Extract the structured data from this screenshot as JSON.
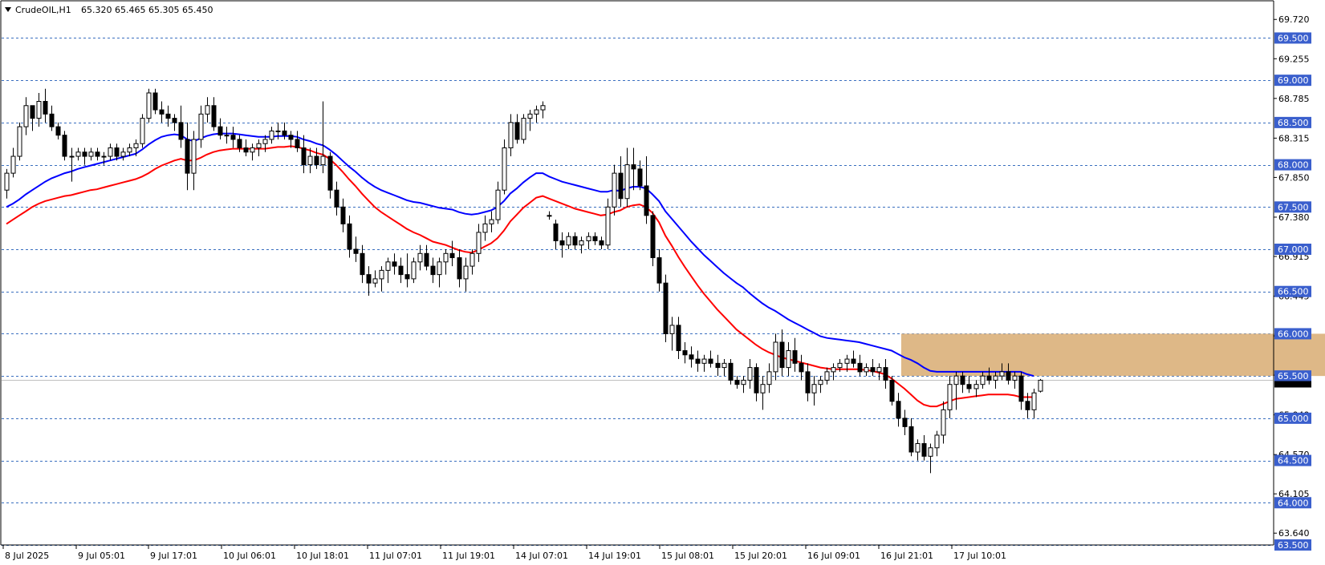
{
  "window": {
    "symbol": "CrudeOIL,H1",
    "ohlc": "65.320 65.465 65.305 65.450"
  },
  "colors": {
    "background": "#ffffff",
    "grid_dash": "#3a6fbf",
    "level_label_bg": "#3a5fcd",
    "ema_fast": "#0000ff",
    "ema_slow": "#ff0000",
    "zone_fill": "#deb887",
    "bull_body": "#ffffff",
    "bear_body": "#000000",
    "current_price_line": "#c0c0c0"
  },
  "chart_data": {
    "type": "candlestick",
    "title": "CrudeOIL,H1",
    "ylim": [
      63.5,
      69.95
    ],
    "y_ticks": [
      "69.720",
      "69.255",
      "68.785",
      "68.315",
      "67.850",
      "67.380",
      "66.915",
      "66.445",
      "65.975",
      "65.510",
      "65.040",
      "64.570",
      "64.105",
      "63.640"
    ],
    "x_tick_labels": [
      "8 Jul 2025",
      "9 Jul 05:01",
      "9 Jul 17:01",
      "10 Jul 06:01",
      "10 Jul 18:01",
      "11 Jul 07:01",
      "11 Jul 19:01",
      "14 Jul 07:01",
      "14 Jul 19:01",
      "15 Jul 08:01",
      "15 Jul 20:01",
      "16 Jul 09:01",
      "16 Jul 21:01",
      "17 Jul 10:01"
    ],
    "levels": [
      "69.500",
      "69.000",
      "68.500",
      "68.000",
      "67.500",
      "67.000",
      "66.500",
      "66.000",
      "65.500",
      "65.000",
      "64.500",
      "64.000",
      "63.500"
    ],
    "current_price": "65.450",
    "zone": {
      "x_start": 139,
      "x_end": 208,
      "y_low": 65.5,
      "y_high": 66.0
    },
    "candles": [
      [
        67.7,
        67.95,
        67.6,
        67.9
      ],
      [
        67.9,
        68.2,
        67.85,
        68.1
      ],
      [
        68.1,
        68.5,
        68.05,
        68.45
      ],
      [
        68.45,
        68.8,
        68.35,
        68.7
      ],
      [
        68.7,
        68.55,
        68.4,
        68.55
      ],
      [
        68.55,
        68.85,
        68.45,
        68.75
      ],
      [
        68.75,
        68.9,
        68.5,
        68.6
      ],
      [
        68.6,
        68.7,
        68.4,
        68.45
      ],
      [
        68.45,
        68.5,
        68.3,
        68.35
      ],
      [
        68.35,
        68.4,
        68.05,
        68.1
      ],
      [
        68.1,
        68.2,
        67.8,
        68.1
      ],
      [
        68.1,
        68.2,
        68.05,
        68.15
      ],
      [
        68.15,
        68.2,
        68.0,
        68.1
      ],
      [
        68.1,
        68.2,
        68.05,
        68.15
      ],
      [
        68.15,
        68.2,
        68.05,
        68.1
      ],
      [
        68.1,
        68.15,
        68.0,
        68.1
      ],
      [
        68.1,
        68.25,
        68.05,
        68.2
      ],
      [
        68.2,
        68.25,
        68.05,
        68.1
      ],
      [
        68.1,
        68.2,
        68.05,
        68.15
      ],
      [
        68.15,
        68.25,
        68.1,
        68.2
      ],
      [
        68.2,
        68.3,
        68.1,
        68.25
      ],
      [
        68.25,
        68.6,
        68.2,
        68.55
      ],
      [
        68.55,
        68.9,
        68.5,
        68.85
      ],
      [
        68.85,
        68.9,
        68.6,
        68.65
      ],
      [
        68.65,
        68.75,
        68.5,
        68.6
      ],
      [
        68.6,
        68.7,
        68.45,
        68.55
      ],
      [
        68.55,
        68.6,
        68.4,
        68.5
      ],
      [
        68.5,
        68.7,
        68.2,
        68.3
      ],
      [
        68.3,
        68.5,
        67.7,
        67.9
      ],
      [
        67.9,
        68.4,
        67.7,
        68.3
      ],
      [
        68.3,
        68.7,
        68.2,
        68.6
      ],
      [
        68.6,
        68.8,
        68.5,
        68.7
      ],
      [
        68.7,
        68.8,
        68.4,
        68.45
      ],
      [
        68.45,
        68.55,
        68.3,
        68.35
      ],
      [
        68.35,
        68.45,
        68.25,
        68.35
      ],
      [
        68.35,
        68.45,
        68.2,
        68.3
      ],
      [
        68.3,
        68.35,
        68.15,
        68.2
      ],
      [
        68.2,
        68.3,
        68.1,
        68.15
      ],
      [
        68.15,
        68.25,
        68.05,
        68.2
      ],
      [
        68.2,
        68.3,
        68.1,
        68.25
      ],
      [
        68.25,
        68.35,
        68.15,
        68.3
      ],
      [
        68.3,
        68.45,
        68.25,
        68.4
      ],
      [
        68.4,
        68.5,
        68.3,
        68.4
      ],
      [
        68.4,
        68.5,
        68.3,
        68.35
      ],
      [
        68.35,
        68.4,
        68.2,
        68.3
      ],
      [
        68.3,
        68.4,
        68.15,
        68.2
      ],
      [
        68.2,
        68.35,
        67.9,
        68.0
      ],
      [
        68.0,
        68.2,
        67.9,
        68.1
      ],
      [
        68.1,
        68.2,
        67.95,
        68.0
      ],
      [
        68.0,
        68.75,
        67.9,
        68.1
      ],
      [
        68.1,
        68.15,
        67.6,
        67.7
      ],
      [
        67.7,
        67.8,
        67.4,
        67.5
      ],
      [
        67.5,
        67.6,
        67.2,
        67.3
      ],
      [
        67.3,
        67.4,
        66.9,
        67.0
      ],
      [
        67.0,
        67.15,
        66.85,
        66.95
      ],
      [
        66.95,
        67.05,
        66.6,
        66.7
      ],
      [
        66.7,
        66.8,
        66.45,
        66.6
      ],
      [
        66.6,
        66.75,
        66.55,
        66.65
      ],
      [
        66.65,
        66.8,
        66.5,
        66.75
      ],
      [
        66.75,
        66.9,
        66.6,
        66.85
      ],
      [
        66.85,
        66.95,
        66.7,
        66.8
      ],
      [
        66.8,
        66.9,
        66.6,
        66.7
      ],
      [
        66.7,
        66.95,
        66.55,
        66.65
      ],
      [
        66.65,
        66.9,
        66.6,
        66.85
      ],
      [
        66.85,
        67.05,
        66.75,
        66.95
      ],
      [
        66.95,
        67.05,
        66.75,
        66.8
      ],
      [
        66.8,
        66.9,
        66.6,
        66.7
      ],
      [
        66.7,
        66.9,
        66.55,
        66.85
      ],
      [
        66.85,
        67.0,
        66.7,
        66.95
      ],
      [
        66.95,
        67.1,
        66.8,
        66.9
      ],
      [
        66.9,
        67.0,
        66.55,
        66.65
      ],
      [
        66.65,
        66.9,
        66.5,
        66.8
      ],
      [
        66.8,
        67.0,
        66.7,
        66.95
      ],
      [
        66.95,
        67.3,
        66.85,
        67.2
      ],
      [
        67.2,
        67.4,
        67.1,
        67.3
      ],
      [
        67.3,
        67.45,
        67.2,
        67.35
      ],
      [
        67.35,
        67.8,
        67.3,
        67.7
      ],
      [
        67.7,
        68.3,
        67.65,
        68.2
      ],
      [
        68.2,
        68.6,
        68.1,
        68.5
      ],
      [
        68.5,
        68.6,
        68.25,
        68.3
      ],
      [
        68.3,
        68.6,
        68.25,
        68.55
      ],
      [
        68.55,
        68.65,
        68.4,
        68.6
      ],
      [
        68.6,
        68.7,
        68.5,
        68.65
      ],
      [
        68.65,
        68.75,
        68.55,
        68.7
      ],
      [
        67.4,
        67.45,
        67.35,
        67.4
      ],
      [
        67.3,
        67.35,
        67.0,
        67.1
      ],
      [
        67.1,
        67.2,
        66.9,
        67.05
      ],
      [
        67.05,
        67.2,
        67.0,
        67.15
      ],
      [
        67.15,
        67.2,
        67.0,
        67.05
      ],
      [
        67.05,
        67.15,
        66.95,
        67.1
      ],
      [
        67.1,
        67.2,
        67.0,
        67.15
      ],
      [
        67.15,
        67.2,
        67.05,
        67.1
      ],
      [
        67.1,
        67.15,
        67.0,
        67.05
      ],
      [
        67.05,
        67.6,
        67.0,
        67.5
      ],
      [
        67.5,
        68.0,
        67.4,
        67.9
      ],
      [
        67.9,
        68.1,
        67.5,
        67.6
      ],
      [
        67.6,
        68.2,
        67.5,
        68.0
      ],
      [
        68.0,
        68.2,
        67.7,
        67.95
      ],
      [
        67.95,
        68.05,
        67.7,
        67.75
      ],
      [
        67.75,
        68.1,
        67.3,
        67.4
      ],
      [
        67.4,
        67.45,
        66.8,
        66.9
      ],
      [
        66.9,
        67.0,
        66.5,
        66.6
      ],
      [
        66.6,
        66.7,
        65.9,
        66.0
      ],
      [
        66.0,
        66.2,
        65.8,
        66.1
      ],
      [
        66.1,
        66.2,
        65.7,
        65.8
      ],
      [
        65.8,
        65.9,
        65.65,
        65.75
      ],
      [
        65.75,
        65.85,
        65.6,
        65.7
      ],
      [
        65.7,
        65.8,
        65.55,
        65.65
      ],
      [
        65.65,
        65.75,
        65.55,
        65.7
      ],
      [
        65.7,
        65.8,
        65.6,
        65.65
      ],
      [
        65.65,
        65.75,
        65.5,
        65.6
      ],
      [
        65.6,
        65.7,
        65.5,
        65.65
      ],
      [
        65.65,
        65.7,
        65.4,
        65.45
      ],
      [
        65.45,
        65.5,
        65.35,
        65.4
      ],
      [
        65.4,
        65.5,
        65.3,
        65.45
      ],
      [
        65.45,
        65.7,
        65.35,
        65.6
      ],
      [
        65.6,
        65.65,
        65.2,
        65.3
      ],
      [
        65.3,
        65.5,
        65.1,
        65.4
      ],
      [
        65.4,
        65.65,
        65.3,
        65.55
      ],
      [
        65.55,
        66.0,
        65.45,
        65.9
      ],
      [
        65.9,
        66.05,
        65.5,
        65.6
      ],
      [
        65.6,
        65.9,
        65.5,
        65.8
      ],
      [
        65.8,
        65.95,
        65.55,
        65.65
      ],
      [
        65.65,
        65.75,
        65.45,
        65.55
      ],
      [
        65.55,
        65.65,
        65.2,
        65.3
      ],
      [
        65.3,
        65.5,
        65.15,
        65.4
      ],
      [
        65.4,
        65.5,
        65.3,
        65.45
      ],
      [
        65.45,
        65.6,
        65.4,
        65.55
      ],
      [
        65.55,
        65.65,
        65.45,
        65.6
      ],
      [
        65.6,
        65.7,
        65.55,
        65.65
      ],
      [
        65.65,
        65.75,
        65.55,
        65.7
      ],
      [
        65.7,
        65.8,
        65.6,
        65.65
      ],
      [
        65.65,
        65.75,
        65.5,
        65.55
      ],
      [
        65.55,
        65.65,
        65.5,
        65.6
      ],
      [
        65.6,
        65.7,
        65.5,
        65.55
      ],
      [
        65.55,
        65.65,
        65.45,
        65.6
      ],
      [
        65.6,
        65.7,
        65.35,
        65.45
      ],
      [
        65.45,
        65.5,
        65.15,
        65.2
      ],
      [
        65.2,
        65.3,
        64.9,
        65.0
      ],
      [
        65.0,
        65.1,
        64.8,
        64.9
      ],
      [
        64.9,
        65.0,
        64.55,
        64.6
      ],
      [
        64.6,
        64.75,
        64.5,
        64.7
      ],
      [
        64.7,
        64.8,
        64.5,
        64.55
      ],
      [
        64.55,
        64.7,
        64.35,
        64.65
      ],
      [
        64.65,
        64.85,
        64.55,
        64.8
      ],
      [
        64.8,
        65.2,
        64.7,
        65.1
      ],
      [
        65.1,
        65.5,
        65.0,
        65.4
      ],
      [
        65.4,
        65.55,
        65.1,
        65.5
      ],
      [
        65.5,
        65.55,
        65.3,
        65.4
      ],
      [
        65.4,
        65.5,
        65.3,
        65.35
      ],
      [
        65.35,
        65.45,
        65.25,
        65.4
      ],
      [
        65.4,
        65.55,
        65.35,
        65.5
      ],
      [
        65.5,
        65.6,
        65.4,
        65.45
      ],
      [
        65.45,
        65.55,
        65.35,
        65.5
      ],
      [
        65.5,
        65.65,
        65.45,
        65.55
      ],
      [
        65.55,
        65.65,
        65.4,
        65.45
      ],
      [
        65.45,
        65.55,
        65.35,
        65.5
      ],
      [
        65.5,
        65.55,
        65.1,
        65.2
      ],
      [
        65.2,
        65.3,
        65.0,
        65.1
      ],
      [
        65.1,
        65.35,
        65.0,
        65.3
      ],
      [
        65.32,
        65.465,
        65.305,
        65.45
      ]
    ],
    "series": [
      {
        "color": "#0000ff",
        "values": [
          67.5,
          67.54,
          67.59,
          67.65,
          67.7,
          67.75,
          67.8,
          67.84,
          67.87,
          67.9,
          67.92,
          67.95,
          67.97,
          67.99,
          68.01,
          68.03,
          68.05,
          68.07,
          68.09,
          68.11,
          68.13,
          68.18,
          68.24,
          68.29,
          68.33,
          68.35,
          68.36,
          68.35,
          68.3,
          68.28,
          68.31,
          68.34,
          68.36,
          68.37,
          68.37,
          68.37,
          68.36,
          68.35,
          68.34,
          68.33,
          68.33,
          68.33,
          68.34,
          68.34,
          68.34,
          68.33,
          68.3,
          68.28,
          68.25,
          68.23,
          68.18,
          68.12,
          68.05,
          67.98,
          67.92,
          67.85,
          67.79,
          67.74,
          67.7,
          67.67,
          67.64,
          67.61,
          67.58,
          67.56,
          67.55,
          67.53,
          67.51,
          67.49,
          67.48,
          67.47,
          67.44,
          67.42,
          67.41,
          67.42,
          67.44,
          67.46,
          67.5,
          67.57,
          67.66,
          67.72,
          67.79,
          67.85,
          67.9,
          67.9,
          67.86,
          67.83,
          67.8,
          67.78,
          67.76,
          67.74,
          67.72,
          67.7,
          67.68,
          67.68,
          67.7,
          67.69,
          67.72,
          67.74,
          67.74,
          67.72,
          67.65,
          67.57,
          67.45,
          67.36,
          67.27,
          67.18,
          67.09,
          67.01,
          66.93,
          66.86,
          66.79,
          66.72,
          66.66,
          66.6,
          66.55,
          66.48,
          66.42,
          66.36,
          66.31,
          66.27,
          66.22,
          66.17,
          66.13,
          66.09,
          66.05,
          66.01,
          65.97,
          65.95,
          65.94,
          65.93,
          65.92,
          65.91,
          65.9,
          65.88,
          65.86,
          65.84,
          65.82,
          65.8,
          65.76,
          65.72,
          65.69,
          65.65,
          65.6,
          65.56,
          65.55,
          65.55,
          65.55,
          65.55,
          65.55,
          65.55,
          65.55,
          65.55,
          65.55,
          65.55,
          65.55,
          65.55,
          65.55,
          65.55,
          65.52,
          65.5
        ]
      },
      {
        "color": "#ff0000",
        "values": [
          67.3,
          67.35,
          67.4,
          67.45,
          67.5,
          67.54,
          67.57,
          67.59,
          67.61,
          67.63,
          67.64,
          67.66,
          67.68,
          67.7,
          67.71,
          67.73,
          67.75,
          67.77,
          67.79,
          67.81,
          67.83,
          67.86,
          67.9,
          67.95,
          67.99,
          68.02,
          68.05,
          68.07,
          68.05,
          68.05,
          68.08,
          68.12,
          68.15,
          68.17,
          68.18,
          68.19,
          68.19,
          68.19,
          68.19,
          68.19,
          68.19,
          68.2,
          68.21,
          68.21,
          68.22,
          68.21,
          68.19,
          68.17,
          68.14,
          68.12,
          68.07,
          68.0,
          67.92,
          67.83,
          67.75,
          67.66,
          67.58,
          67.5,
          67.44,
          67.39,
          67.34,
          67.29,
          67.24,
          67.2,
          67.17,
          67.13,
          67.09,
          67.07,
          67.05,
          67.02,
          66.99,
          66.97,
          66.96,
          66.99,
          67.03,
          67.07,
          67.13,
          67.22,
          67.33,
          67.41,
          67.49,
          67.55,
          67.61,
          67.63,
          67.6,
          67.57,
          67.54,
          67.51,
          67.48,
          67.46,
          67.44,
          67.42,
          67.4,
          67.41,
          67.44,
          67.46,
          67.5,
          67.52,
          67.53,
          67.5,
          67.43,
          67.32,
          67.16,
          67.04,
          66.91,
          66.79,
          66.68,
          66.57,
          66.47,
          66.38,
          66.29,
          66.21,
          66.13,
          66.05,
          65.99,
          65.93,
          65.87,
          65.82,
          65.78,
          65.75,
          65.72,
          65.7,
          65.68,
          65.66,
          65.64,
          65.62,
          65.6,
          65.59,
          65.58,
          65.58,
          65.58,
          65.58,
          65.58,
          65.57,
          65.56,
          65.54,
          65.52,
          65.47,
          65.41,
          65.35,
          65.28,
          65.21,
          65.16,
          65.14,
          65.14,
          65.17,
          65.2,
          65.23,
          65.24,
          65.25,
          65.26,
          65.27,
          65.28,
          65.28,
          65.28,
          65.28,
          65.27,
          65.25,
          65.25,
          65.25
        ]
      }
    ]
  }
}
